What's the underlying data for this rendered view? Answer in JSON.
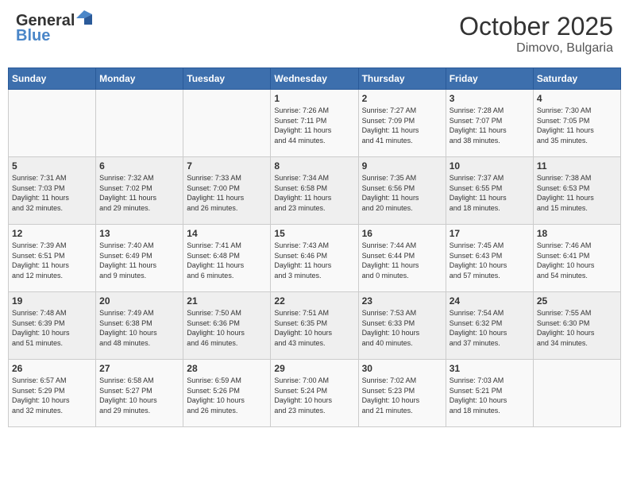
{
  "header": {
    "logo_general": "General",
    "logo_blue": "Blue",
    "month_title": "October 2025",
    "location": "Dimovo, Bulgaria"
  },
  "weekdays": [
    "Sunday",
    "Monday",
    "Tuesday",
    "Wednesday",
    "Thursday",
    "Friday",
    "Saturday"
  ],
  "weeks": [
    [
      {
        "day": "",
        "info": ""
      },
      {
        "day": "",
        "info": ""
      },
      {
        "day": "",
        "info": ""
      },
      {
        "day": "1",
        "info": "Sunrise: 7:26 AM\nSunset: 7:11 PM\nDaylight: 11 hours\nand 44 minutes."
      },
      {
        "day": "2",
        "info": "Sunrise: 7:27 AM\nSunset: 7:09 PM\nDaylight: 11 hours\nand 41 minutes."
      },
      {
        "day": "3",
        "info": "Sunrise: 7:28 AM\nSunset: 7:07 PM\nDaylight: 11 hours\nand 38 minutes."
      },
      {
        "day": "4",
        "info": "Sunrise: 7:30 AM\nSunset: 7:05 PM\nDaylight: 11 hours\nand 35 minutes."
      }
    ],
    [
      {
        "day": "5",
        "info": "Sunrise: 7:31 AM\nSunset: 7:03 PM\nDaylight: 11 hours\nand 32 minutes."
      },
      {
        "day": "6",
        "info": "Sunrise: 7:32 AM\nSunset: 7:02 PM\nDaylight: 11 hours\nand 29 minutes."
      },
      {
        "day": "7",
        "info": "Sunrise: 7:33 AM\nSunset: 7:00 PM\nDaylight: 11 hours\nand 26 minutes."
      },
      {
        "day": "8",
        "info": "Sunrise: 7:34 AM\nSunset: 6:58 PM\nDaylight: 11 hours\nand 23 minutes."
      },
      {
        "day": "9",
        "info": "Sunrise: 7:35 AM\nSunset: 6:56 PM\nDaylight: 11 hours\nand 20 minutes."
      },
      {
        "day": "10",
        "info": "Sunrise: 7:37 AM\nSunset: 6:55 PM\nDaylight: 11 hours\nand 18 minutes."
      },
      {
        "day": "11",
        "info": "Sunrise: 7:38 AM\nSunset: 6:53 PM\nDaylight: 11 hours\nand 15 minutes."
      }
    ],
    [
      {
        "day": "12",
        "info": "Sunrise: 7:39 AM\nSunset: 6:51 PM\nDaylight: 11 hours\nand 12 minutes."
      },
      {
        "day": "13",
        "info": "Sunrise: 7:40 AM\nSunset: 6:49 PM\nDaylight: 11 hours\nand 9 minutes."
      },
      {
        "day": "14",
        "info": "Sunrise: 7:41 AM\nSunset: 6:48 PM\nDaylight: 11 hours\nand 6 minutes."
      },
      {
        "day": "15",
        "info": "Sunrise: 7:43 AM\nSunset: 6:46 PM\nDaylight: 11 hours\nand 3 minutes."
      },
      {
        "day": "16",
        "info": "Sunrise: 7:44 AM\nSunset: 6:44 PM\nDaylight: 11 hours\nand 0 minutes."
      },
      {
        "day": "17",
        "info": "Sunrise: 7:45 AM\nSunset: 6:43 PM\nDaylight: 10 hours\nand 57 minutes."
      },
      {
        "day": "18",
        "info": "Sunrise: 7:46 AM\nSunset: 6:41 PM\nDaylight: 10 hours\nand 54 minutes."
      }
    ],
    [
      {
        "day": "19",
        "info": "Sunrise: 7:48 AM\nSunset: 6:39 PM\nDaylight: 10 hours\nand 51 minutes."
      },
      {
        "day": "20",
        "info": "Sunrise: 7:49 AM\nSunset: 6:38 PM\nDaylight: 10 hours\nand 48 minutes."
      },
      {
        "day": "21",
        "info": "Sunrise: 7:50 AM\nSunset: 6:36 PM\nDaylight: 10 hours\nand 46 minutes."
      },
      {
        "day": "22",
        "info": "Sunrise: 7:51 AM\nSunset: 6:35 PM\nDaylight: 10 hours\nand 43 minutes."
      },
      {
        "day": "23",
        "info": "Sunrise: 7:53 AM\nSunset: 6:33 PM\nDaylight: 10 hours\nand 40 minutes."
      },
      {
        "day": "24",
        "info": "Sunrise: 7:54 AM\nSunset: 6:32 PM\nDaylight: 10 hours\nand 37 minutes."
      },
      {
        "day": "25",
        "info": "Sunrise: 7:55 AM\nSunset: 6:30 PM\nDaylight: 10 hours\nand 34 minutes."
      }
    ],
    [
      {
        "day": "26",
        "info": "Sunrise: 6:57 AM\nSunset: 5:29 PM\nDaylight: 10 hours\nand 32 minutes."
      },
      {
        "day": "27",
        "info": "Sunrise: 6:58 AM\nSunset: 5:27 PM\nDaylight: 10 hours\nand 29 minutes."
      },
      {
        "day": "28",
        "info": "Sunrise: 6:59 AM\nSunset: 5:26 PM\nDaylight: 10 hours\nand 26 minutes."
      },
      {
        "day": "29",
        "info": "Sunrise: 7:00 AM\nSunset: 5:24 PM\nDaylight: 10 hours\nand 23 minutes."
      },
      {
        "day": "30",
        "info": "Sunrise: 7:02 AM\nSunset: 5:23 PM\nDaylight: 10 hours\nand 21 minutes."
      },
      {
        "day": "31",
        "info": "Sunrise: 7:03 AM\nSunset: 5:21 PM\nDaylight: 10 hours\nand 18 minutes."
      },
      {
        "day": "",
        "info": ""
      }
    ]
  ]
}
